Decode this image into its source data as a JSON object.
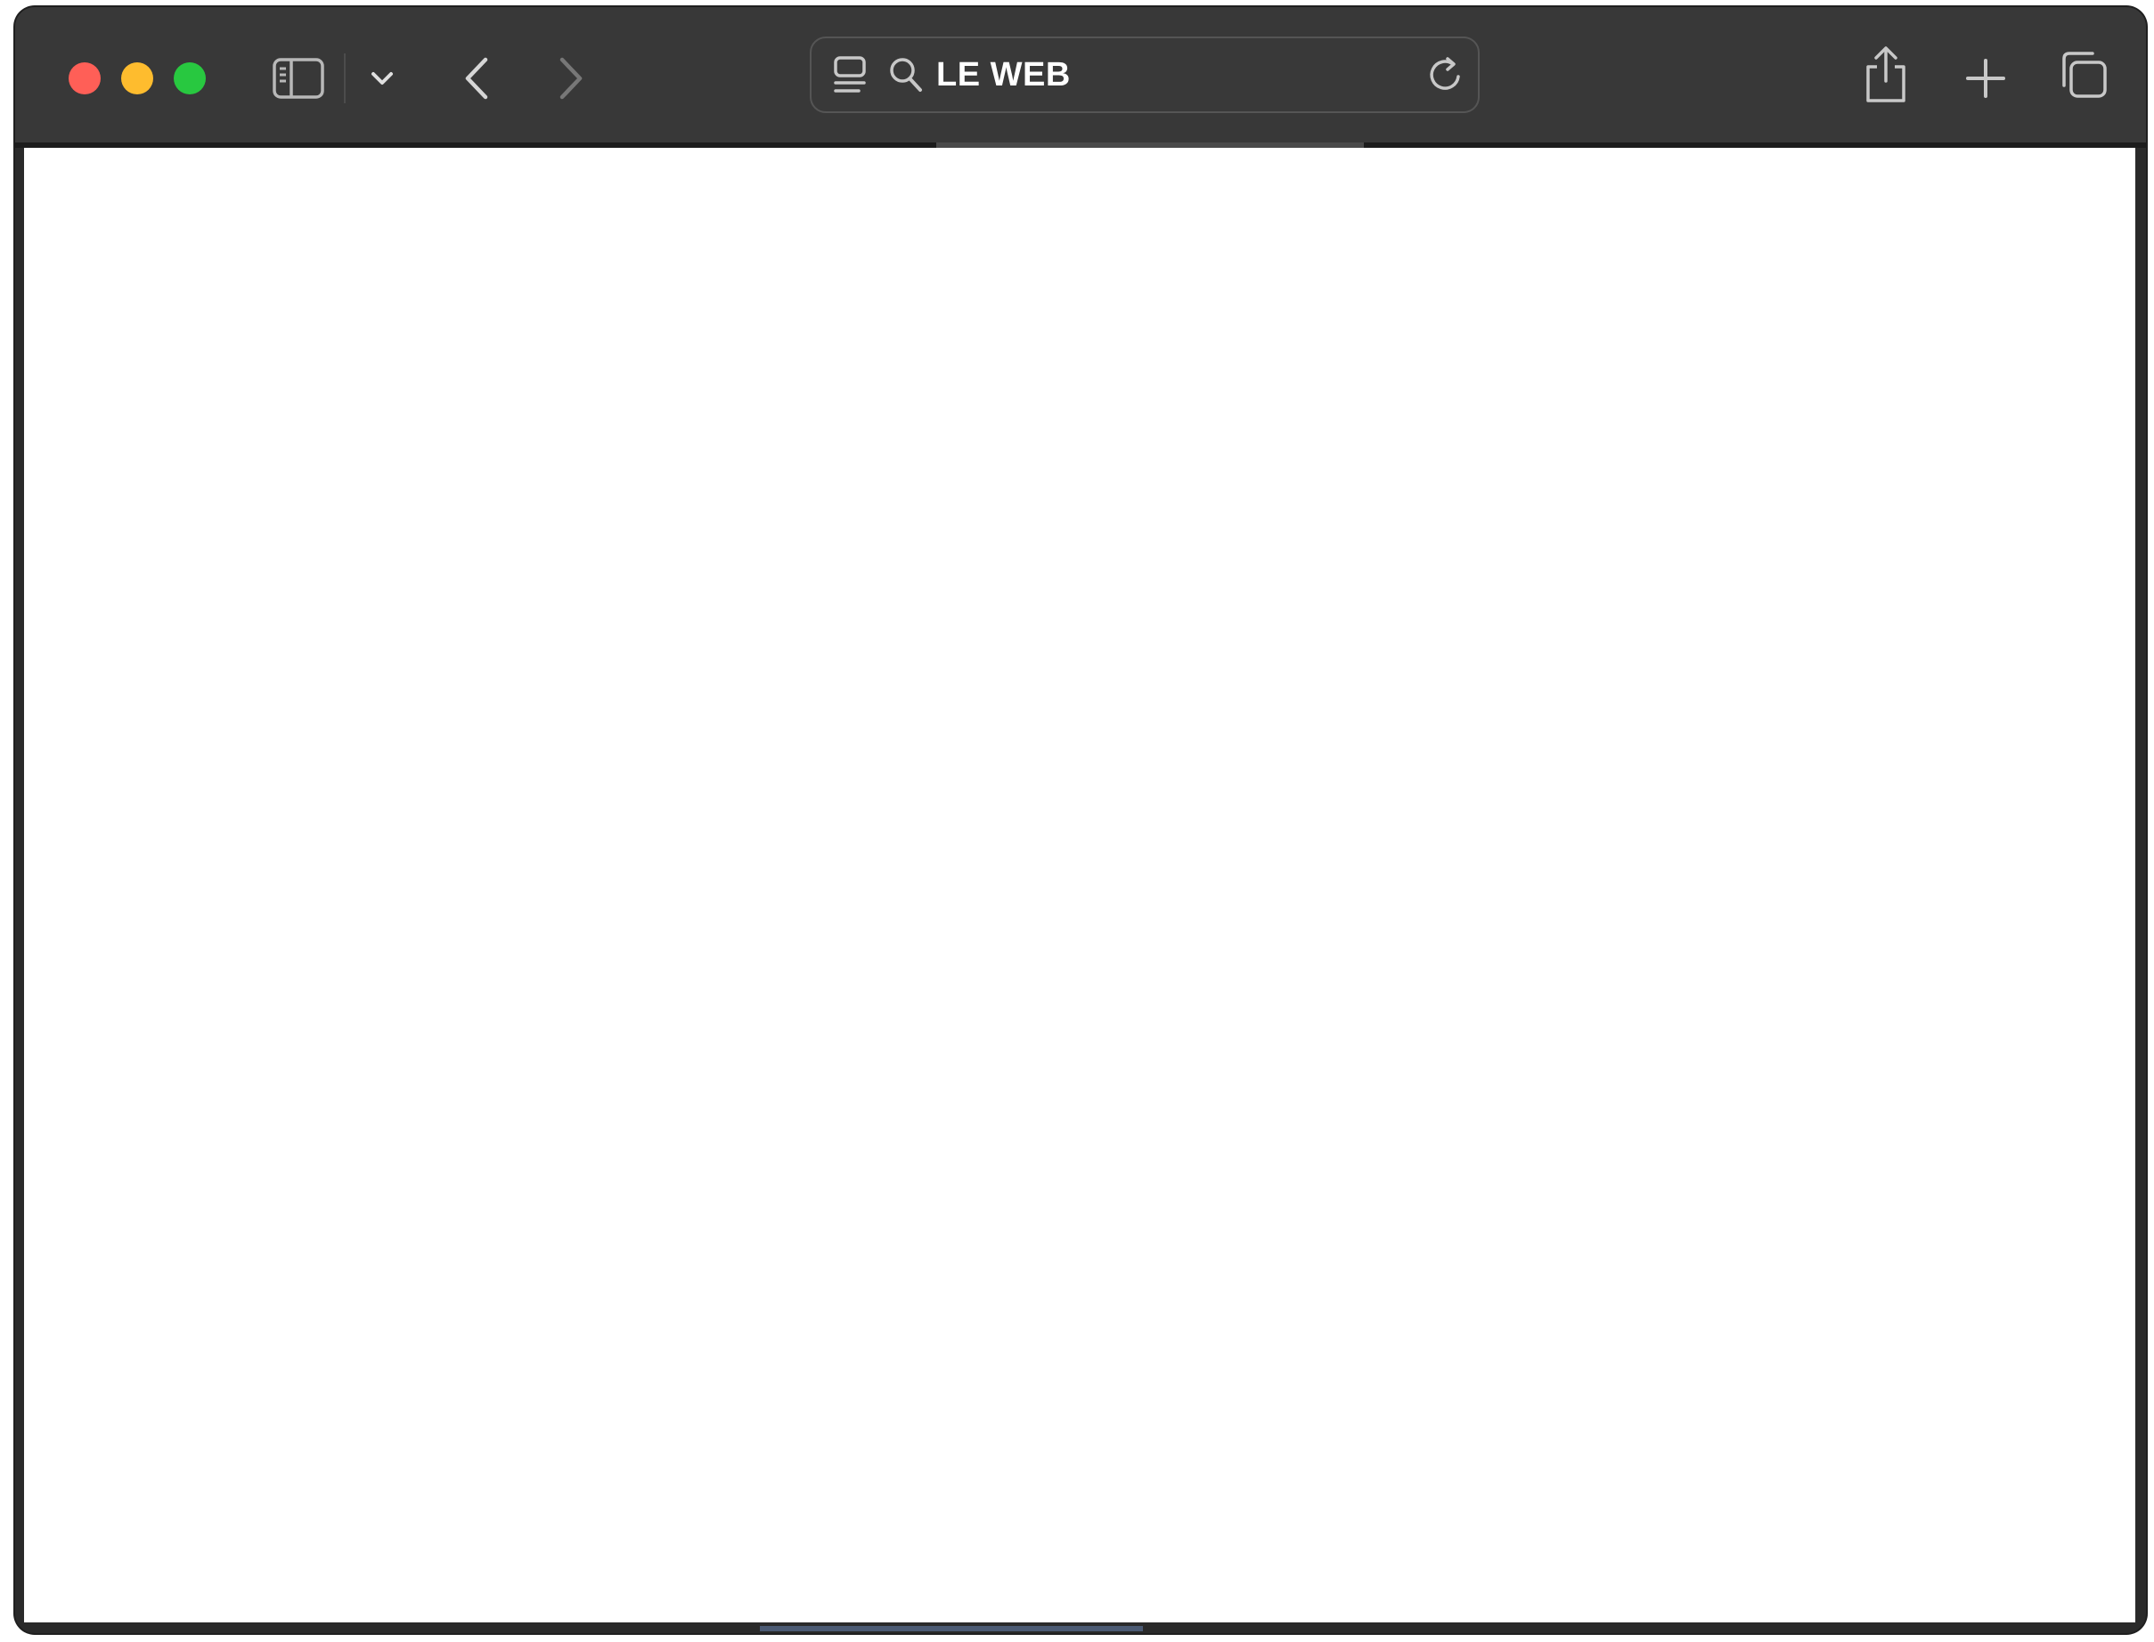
{
  "browser": {
    "address_bar": {
      "text": "LE WEB"
    },
    "icons": {
      "close": "close-window-icon",
      "minimize": "minimize-window-icon",
      "zoom": "zoom-window-icon",
      "sidebar": "sidebar-icon",
      "tab_group_menu": "chevron-down-icon",
      "back": "back-arrow-icon",
      "forward": "forward-arrow-icon",
      "page_menu": "page-menu-icon",
      "search": "search-icon",
      "reload": "reload-icon",
      "share": "share-icon",
      "new_tab": "plus-icon",
      "tab_overview": "tab-overview-icon"
    },
    "colors": {
      "toolbar": "#383838",
      "close": "#ff5f57",
      "minimize": "#febc2e",
      "zoom": "#28c840",
      "page_background": "#ffffff"
    }
  }
}
